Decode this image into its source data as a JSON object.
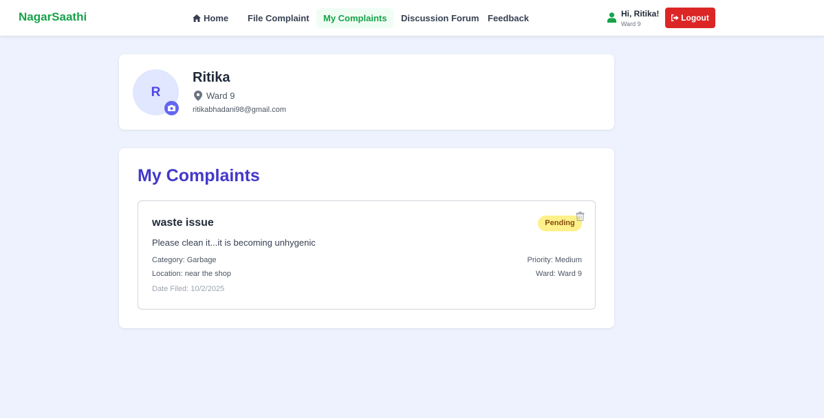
{
  "navbar": {
    "brand": "NagarSaathi",
    "links": [
      {
        "label": "Home",
        "icon": "home-icon"
      },
      {
        "label": "File Complaint"
      },
      {
        "label": "My Complaints",
        "active": true
      },
      {
        "label": "Discussion Forum"
      },
      {
        "label": "Feedback"
      }
    ],
    "user": {
      "greeting": "Hi, Ritika!",
      "ward": "Ward 9",
      "icon": "user-icon"
    },
    "logout_label": "Logout"
  },
  "profile": {
    "initial": "R",
    "name": "Ritika",
    "ward": "Ward 9",
    "email": "ritikabhadani98@gmail.com"
  },
  "complaints": {
    "title": "My Complaints",
    "items": [
      {
        "title": "waste issue",
        "status": "Pending",
        "description": "Please clean it...it is becoming unhygenic",
        "category": "Category: Garbage",
        "location": "Location: near the shop",
        "date_filed": "Date Filed: 10/2/2025",
        "priority": "Priority: Medium",
        "ward": "Ward: Ward 9"
      }
    ]
  },
  "colors": {
    "brand": "#16a34a",
    "accent": "#4338ca",
    "logout": "#dc2626",
    "pending_badge": "#fef08a",
    "page_bg": "#eef2fe"
  }
}
